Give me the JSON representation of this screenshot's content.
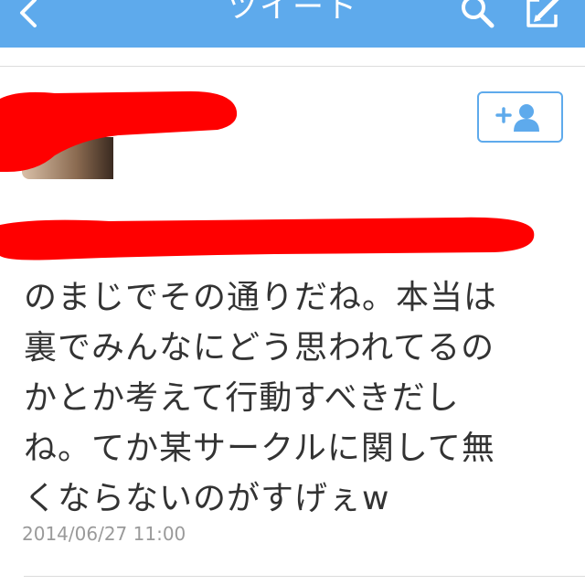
{
  "header": {
    "title": "ツイート"
  },
  "tweet": {
    "text": "のまじでその通りだね。本当は\n裏でみんなにどう思われてるの\nかとか考えて行動すべきだし\nね。てか某サークルに関して無\nくならないのがすげぇw",
    "timestamp": "2014/06/27 11:00"
  },
  "colors": {
    "navbar": "#5eaaec",
    "accent": "#5eaaec",
    "redaction": "#ff0000"
  },
  "icons": {
    "back": "chevron-left-icon",
    "search": "search-icon",
    "compose": "compose-icon",
    "follow": "add-user-icon"
  }
}
